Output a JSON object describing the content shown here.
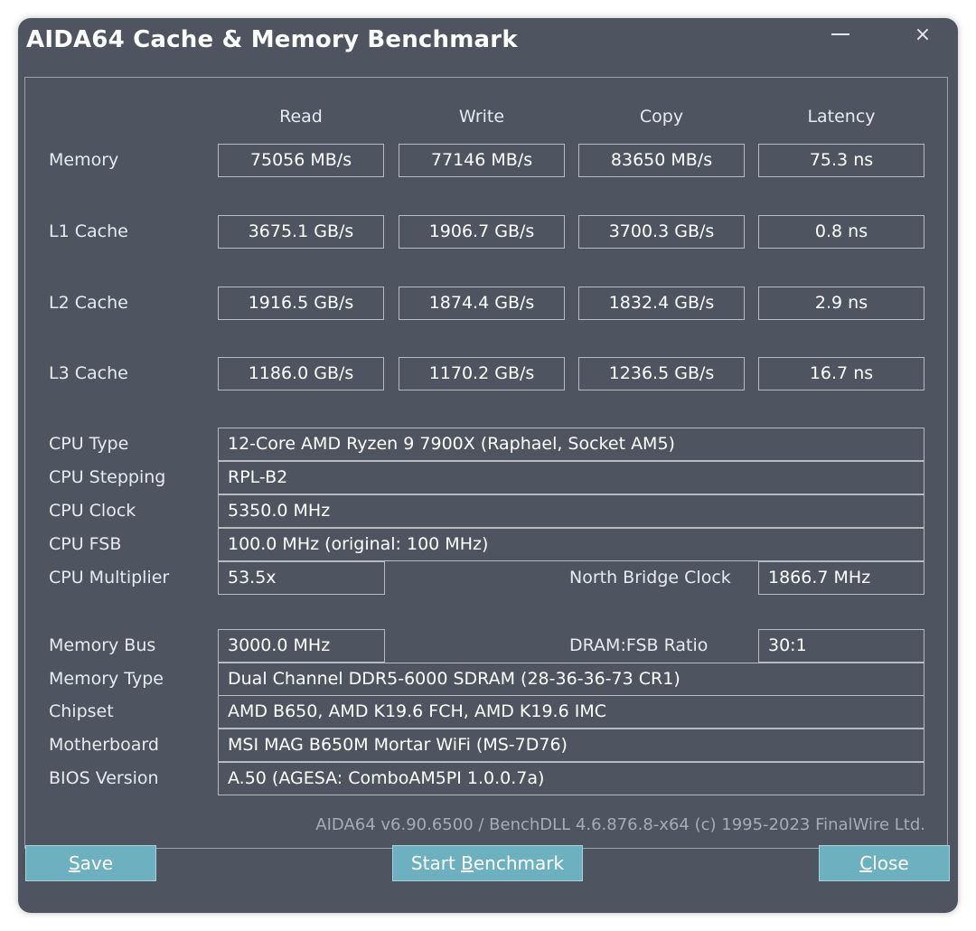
{
  "window": {
    "title": "AIDA64 Cache & Memory Benchmark",
    "minimize_icon": "minimize-icon",
    "close_icon": "close-icon",
    "close_glyph": "×"
  },
  "columns": [
    "Read",
    "Write",
    "Copy",
    "Latency"
  ],
  "benchmarks": [
    {
      "label": "Memory",
      "read": "75056 MB/s",
      "write": "77146 MB/s",
      "copy": "83650 MB/s",
      "latency": "75.3 ns"
    },
    {
      "label": "L1 Cache",
      "read": "3675.1 GB/s",
      "write": "1906.7 GB/s",
      "copy": "3700.3 GB/s",
      "latency": "0.8 ns"
    },
    {
      "label": "L2 Cache",
      "read": "1916.5 GB/s",
      "write": "1874.4 GB/s",
      "copy": "1832.4 GB/s",
      "latency": "2.9 ns"
    },
    {
      "label": "L3 Cache",
      "read": "1186.0 GB/s",
      "write": "1170.2 GB/s",
      "copy": "1236.5 GB/s",
      "latency": "16.7 ns"
    }
  ],
  "cpu": {
    "type_label": "CPU Type",
    "type_value": "12-Core AMD Ryzen 9 7900X  (Raphael, Socket AM5)",
    "stepping_label": "CPU Stepping",
    "stepping_value": "RPL-B2",
    "clock_label": "CPU Clock",
    "clock_value": "5350.0 MHz",
    "fsb_label": "CPU FSB",
    "fsb_value": "100.0 MHz  (original: 100 MHz)",
    "multiplier_label": "CPU Multiplier",
    "multiplier_value": "53.5x",
    "nb_clock_label": "North Bridge Clock",
    "nb_clock_value": "1866.7 MHz"
  },
  "memory": {
    "bus_label": "Memory Bus",
    "bus_value": "3000.0 MHz",
    "ratio_label": "DRAM:FSB Ratio",
    "ratio_value": "30:1",
    "type_label": "Memory Type",
    "type_value": "Dual Channel DDR5-6000 SDRAM  (28-36-36-73 CR1)",
    "chipset_label": "Chipset",
    "chipset_value": "AMD B650, AMD K19.6 FCH, AMD K19.6 IMC",
    "motherboard_label": "Motherboard",
    "motherboard_value": "MSI MAG B650M Mortar WiFi (MS-7D76)",
    "bios_label": "BIOS Version",
    "bios_value": "A.50  (AGESA: ComboAM5PI 1.0.0.7a)"
  },
  "footer": "AIDA64 v6.90.6500 / BenchDLL 4.6.876.8-x64  (c) 1995-2023 FinalWire Ltd.",
  "buttons": {
    "save": {
      "first": "S",
      "rest": "ave"
    },
    "start": {
      "pre": "Start ",
      "first": "B",
      "rest": "enchmark"
    },
    "close": {
      "first": "C",
      "rest": "lose"
    }
  }
}
